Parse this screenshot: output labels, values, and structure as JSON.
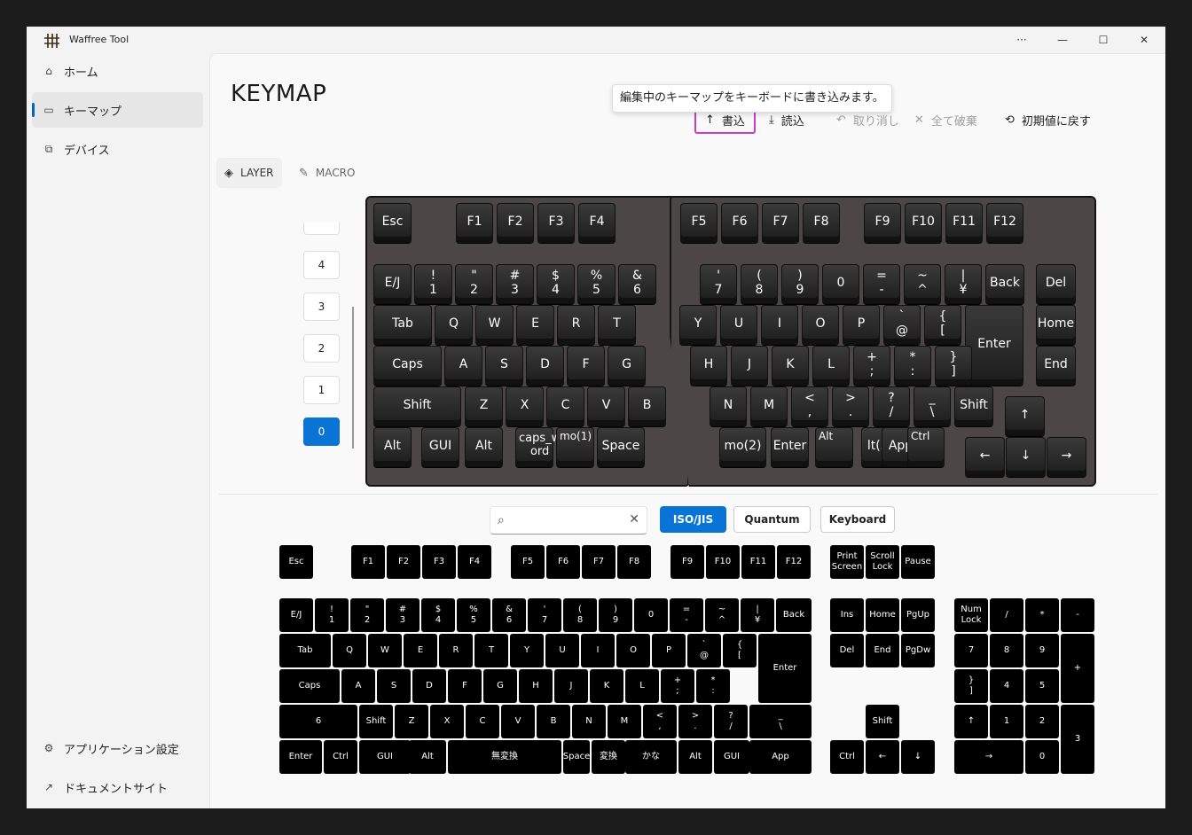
{
  "app": {
    "title": "Waffree Tool"
  },
  "window_controls": {
    "more": "···",
    "minimize": "—",
    "maximize": "☐",
    "close": "✕"
  },
  "sidebar": {
    "items": [
      {
        "label": "ホーム",
        "icon": "home-icon"
      },
      {
        "label": "キーマップ",
        "icon": "keyboard-icon"
      },
      {
        "label": "デバイス",
        "icon": "device-icon"
      }
    ],
    "bottom": [
      {
        "label": "アプリケーション設定",
        "icon": "gear-icon"
      },
      {
        "label": "ドキュメントサイト",
        "icon": "external-link-icon"
      }
    ]
  },
  "page": {
    "title": "KEYMAP"
  },
  "tooltip": "編集中のキーマップをキーボードに書き込みます。",
  "toolbar": {
    "write": "書込",
    "read": "読込",
    "undo": "取り消し",
    "discard": "全て破棄",
    "reset": "初期値に戻す"
  },
  "tabs": {
    "layer": "LAYER",
    "macro": "MACRO"
  },
  "layers": [
    "4",
    "3",
    "2",
    "1",
    "0"
  ],
  "search": {
    "placeholder": ""
  },
  "categories": [
    "ISO/JIS",
    "Quantum",
    "Keyboard"
  ],
  "colors": {
    "accent": "#0a74d6",
    "key_bg": "#1c1c1c",
    "board_bg": "#4c4746",
    "highlight": "#c83cc8"
  },
  "keymap_keys": [
    "Esc",
    "F1",
    "F2",
    "F3",
    "F4",
    "F5",
    "F6",
    "F7",
    "F8",
    "F9",
    "F10",
    "F11",
    "F12",
    "E/J",
    "!\n1",
    "\"\n2",
    "#\n3",
    "$\n4",
    "%\n5",
    "&\n6",
    "'\n7",
    "(\n8",
    ")\n9",
    "0",
    "=\n-",
    "~\n^",
    "|\n¥",
    "Back",
    "Del",
    "Tab",
    "Q",
    "W",
    "E",
    "R",
    "T",
    "Y",
    "U",
    "I",
    "O",
    "P",
    "`\n@",
    "{\n[",
    "Enter",
    "Home",
    "Caps",
    "A",
    "S",
    "D",
    "F",
    "G",
    "H",
    "J",
    "K",
    "L",
    "+\n;",
    "*\n:",
    "}\n]",
    "End",
    "Shift",
    "Z",
    "X",
    "C",
    "V",
    "B",
    "N",
    "M",
    "<\n,",
    ">\n.",
    "?\n/",
    "_\n\\",
    "Shift",
    "↑",
    "Alt",
    "GUI",
    "Alt",
    "caps_w\nord",
    "mo(1)",
    "Space",
    "mo(2)",
    "Enter",
    "Alt",
    "lt(3)",
    "App",
    "Ctrl",
    "←",
    "↓",
    "→"
  ],
  "palette_keys": [
    "Esc",
    "F1",
    "F2",
    "F3",
    "F4",
    "F5",
    "F6",
    "F7",
    "F8",
    "F9",
    "F10",
    "F11",
    "F12",
    "Print\nScreen",
    "Scroll\nLock",
    "Pause",
    "E/J",
    "!\n1",
    "\"\n2",
    "#\n3",
    "$\n4",
    "%\n5",
    "&\n6",
    "'\n7",
    "(\n8",
    ")\n9",
    "0",
    "=\n-",
    "~\n^",
    "|\n¥",
    "Back",
    "Ins",
    "Home",
    "PgUp",
    "Num\nLock",
    "/",
    "*",
    "-",
    "Tab",
    "Q",
    "W",
    "E",
    "R",
    "T",
    "Y",
    "U",
    "I",
    "O",
    "P",
    "`\n@",
    "{\n[",
    "Enter",
    "Del",
    "End",
    "PgDw",
    "7",
    "8",
    "9",
    "+",
    "Caps",
    "A",
    "S",
    "D",
    "F",
    "G",
    "H",
    "J",
    "K",
    "L",
    "+\n;",
    "*\n:",
    "}\n]",
    "4",
    "5",
    "6",
    "Shift",
    "Z",
    "X",
    "C",
    "V",
    "B",
    "N",
    "M",
    "<\n,",
    ">\n.",
    "?\n/",
    "_\n\\",
    "Shift",
    "↑",
    "1",
    "2",
    "3",
    "Enter",
    "Ctrl",
    "GUI",
    "Alt",
    "無変換",
    "Space",
    "変換",
    "かな",
    "Alt",
    "GUI",
    "App",
    "Ctrl",
    "←",
    "↓",
    "→",
    "0",
    "."
  ]
}
